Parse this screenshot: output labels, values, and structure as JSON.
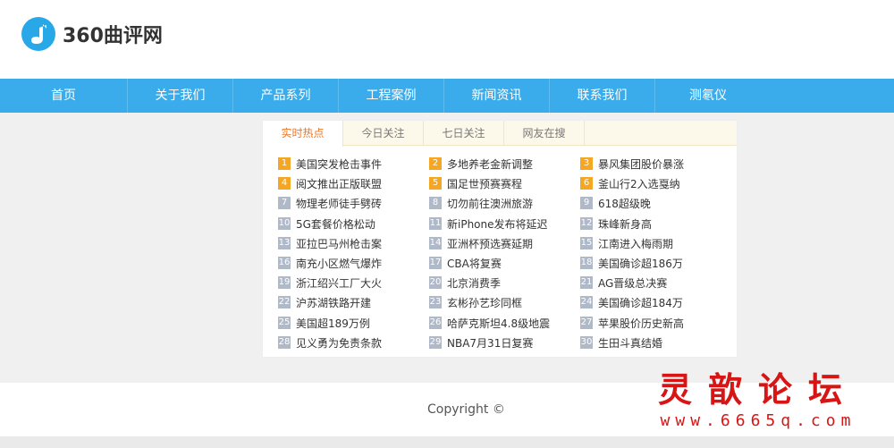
{
  "header": {
    "logo_text": "360曲评网",
    "logo_icon": "music-note-icon"
  },
  "nav": {
    "items": [
      "首页",
      "关于我们",
      "产品系列",
      "工程案例",
      "新闻资讯",
      "联系我们",
      "测氡仪"
    ]
  },
  "tabs": [
    {
      "label": "实时热点",
      "active": true
    },
    {
      "label": "今日关注",
      "active": false
    },
    {
      "label": "七日关注",
      "active": false
    },
    {
      "label": "网友在搜",
      "active": false
    }
  ],
  "hot_list": [
    {
      "num": "1",
      "title": "美国突发枪击事件"
    },
    {
      "num": "2",
      "title": "多地养老金新调整"
    },
    {
      "num": "3",
      "title": "暴风集团股价暴涨"
    },
    {
      "num": "4",
      "title": "阅文推出正版联盟"
    },
    {
      "num": "5",
      "title": "国足世预赛赛程"
    },
    {
      "num": "6",
      "title": "釜山行2入选戛纳"
    },
    {
      "num": "7",
      "title": "物理老师徒手劈砖"
    },
    {
      "num": "8",
      "title": "切勿前往澳洲旅游"
    },
    {
      "num": "9",
      "title": "618超级晚"
    },
    {
      "num": "10",
      "title": "5G套餐价格松动"
    },
    {
      "num": "11",
      "title": "新iPhone发布将延迟"
    },
    {
      "num": "12",
      "title": "珠峰新身高"
    },
    {
      "num": "13",
      "title": "亚拉巴马州枪击案"
    },
    {
      "num": "14",
      "title": "亚洲杯预选赛延期"
    },
    {
      "num": "15",
      "title": "江南进入梅雨期"
    },
    {
      "num": "16",
      "title": "南充小区燃气爆炸"
    },
    {
      "num": "17",
      "title": "CBA将复赛"
    },
    {
      "num": "18",
      "title": "美国确诊超186万"
    },
    {
      "num": "19",
      "title": "浙江绍兴工厂大火"
    },
    {
      "num": "20",
      "title": "北京消费季"
    },
    {
      "num": "21",
      "title": "AG晋级总决赛"
    },
    {
      "num": "22",
      "title": "沪苏湖铁路开建"
    },
    {
      "num": "23",
      "title": "玄彬孙艺珍同框"
    },
    {
      "num": "24",
      "title": "美国确诊超184万"
    },
    {
      "num": "25",
      "title": "美国超189万例"
    },
    {
      "num": "26",
      "title": "哈萨克斯坦4.8级地震"
    },
    {
      "num": "27",
      "title": "苹果股价历史新高"
    },
    {
      "num": "28",
      "title": "见义勇为免责条款"
    },
    {
      "num": "29",
      "title": "NBA7月31日复赛"
    },
    {
      "num": "30",
      "title": "生田斗真结婚"
    }
  ],
  "colors": {
    "nav_bg": "#3aacec",
    "hot_badge": "#f5a623",
    "normal_badge": "#b0b9c8",
    "active_tab_text": "#e8782a"
  },
  "footer": {
    "copyright": "Copyright ©"
  },
  "watermark": {
    "title": "灵歆论坛",
    "url": "www.6665q.com"
  }
}
